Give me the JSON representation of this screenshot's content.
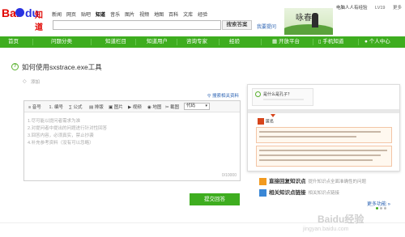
{
  "header": {
    "logo_bai": "Bai",
    "logo_du": "du",
    "logo_zhidao": "知道",
    "nav": [
      "新闻",
      "网页",
      "贴吧",
      "知道",
      "音乐",
      "图片",
      "视频",
      "地图",
      "百科",
      "文库",
      "经验"
    ],
    "nav_active_index": 3,
    "search_value": "",
    "search_button": "搜索答案",
    "ask_link": "我要提问",
    "banner_text": "咏春",
    "user_name": "电脑人人有经验",
    "user_level": "LV19",
    "user_more": "更多"
  },
  "green_nav": {
    "items": [
      "首页",
      "问题分类",
      "知道栏目",
      "知道用户",
      "咨询专家",
      "经验"
    ],
    "right_items": [
      "开放平台",
      "手机知道",
      "个人中心"
    ]
  },
  "question": {
    "title": "如何使用sxstrace.exe工具",
    "tag_label": "添加",
    "ref_link": "搜索相关资料"
  },
  "editor": {
    "toolbar": [
      "公式",
      "图片",
      "排版",
      "视频",
      "地图",
      "附件",
      "截图"
    ],
    "toolbar_first": "音号",
    "toolbar_second": "编号",
    "code_select": "代码",
    "hints": [
      "1.尽可能以提问者需求为准",
      "2.对提问者中提出的问题进行针对性回答",
      "3.回答内容，必须真实，禁止抄袭",
      "4.补充参考资料（没有可以忽略）"
    ],
    "counter": "0/10000"
  },
  "submit": "提交回答",
  "right_panel": {
    "preview_question": "是什么是孔子？",
    "preview_user": "匿名",
    "feature1_title": "直接回复知识点",
    "feature1_sub": "提升知识点全面准确性的问题",
    "feature2_title": "相关知识点链接",
    "feature2_sub": "相关知识点链接",
    "more": "更多功能"
  },
  "watermark": "Baidu经验",
  "watermark_sub": "jingyan.baidu.com",
  "colors": {
    "brand_green": "#3ead1f",
    "brand_red": "#e10602",
    "brand_blue": "#2932e1",
    "link_blue": "#2d64b3"
  }
}
